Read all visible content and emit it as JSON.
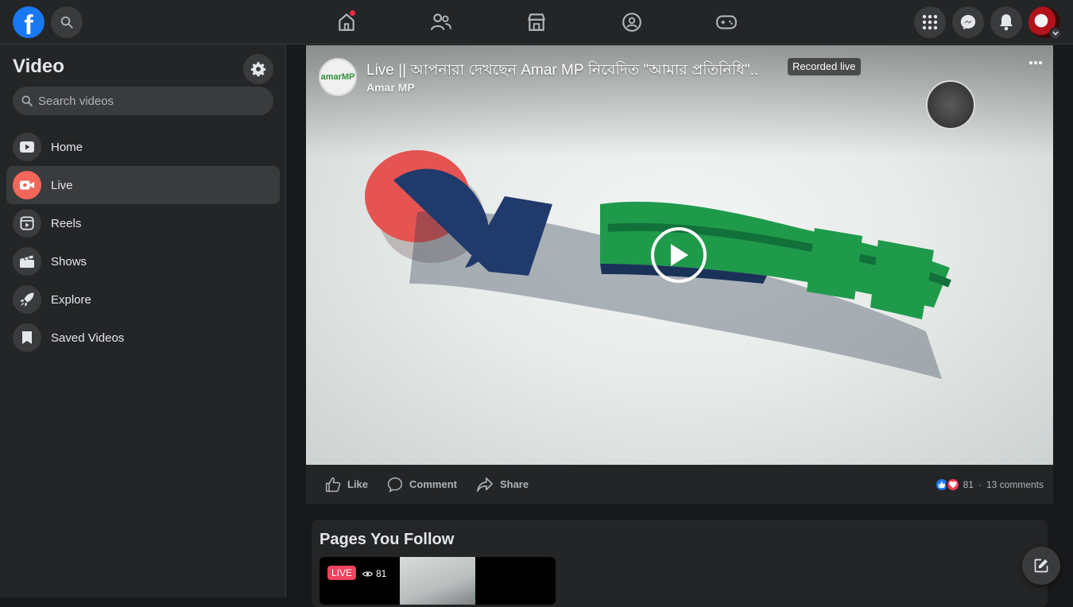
{
  "app": {
    "logo_letter": "f"
  },
  "sidebar": {
    "title": "Video",
    "search_placeholder": "Search videos",
    "items": [
      {
        "label": "Home",
        "icon": "play-icon"
      },
      {
        "label": "Live",
        "icon": "live-camera-icon",
        "active": true
      },
      {
        "label": "Reels",
        "icon": "reels-icon"
      },
      {
        "label": "Shows",
        "icon": "clapper-icon"
      },
      {
        "label": "Explore",
        "icon": "rocket-icon"
      },
      {
        "label": "Saved Videos",
        "icon": "bookmark-icon"
      }
    ]
  },
  "video": {
    "title": "Live || আপনারা দেখছেন Amar MP নিবেদিত \"আমার প্রতিনিধি\"..",
    "badge": "Recorded live",
    "owner": "Amar MP",
    "avatar_text": "amarMP",
    "actions": {
      "like": "Like",
      "comment": "Comment",
      "share": "Share"
    },
    "reaction_count": "81",
    "comments": "13 comments"
  },
  "pages_you_follow": {
    "title": "Pages You Follow",
    "live_badge": "LIVE",
    "viewers": "81"
  },
  "colors": {
    "accent": "#1877f2",
    "live": "#f3425f",
    "active_icon_bg": "#f3665a"
  }
}
